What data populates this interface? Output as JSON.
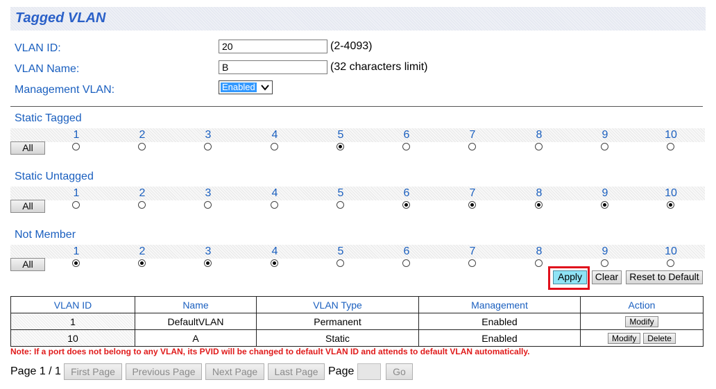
{
  "page": {
    "title": "Tagged VLAN"
  },
  "form": {
    "vlan_id_label": "VLAN ID:",
    "vlan_id_value": "20",
    "vlan_id_hint": "(2-4093)",
    "vlan_name_label": "VLAN Name:",
    "vlan_name_value": "B",
    "vlan_name_hint": "(32 characters limit)",
    "mgmt_label": "Management VLAN:",
    "mgmt_value": "Enabled"
  },
  "membership": {
    "all_label": "All",
    "ports": [
      "1",
      "2",
      "3",
      "4",
      "5",
      "6",
      "7",
      "8",
      "9",
      "10"
    ],
    "sections": [
      {
        "title": "Static Tagged",
        "selected": [
          5
        ]
      },
      {
        "title": "Static Untagged",
        "selected": [
          6,
          7,
          8,
          9,
          10
        ]
      },
      {
        "title": "Not Member",
        "selected": [
          1,
          2,
          3,
          4
        ]
      }
    ]
  },
  "actions": {
    "apply": "Apply",
    "clear": "Clear",
    "reset": "Reset to Default"
  },
  "table": {
    "headers": [
      "VLAN ID",
      "Name",
      "VLAN Type",
      "Management",
      "Action"
    ],
    "rows": [
      {
        "id": "1",
        "name": "DefaultVLAN",
        "type": "Permanent",
        "management": "Enabled",
        "actions": [
          "Modify"
        ]
      },
      {
        "id": "10",
        "name": "A",
        "type": "Static",
        "management": "Enabled",
        "actions": [
          "Modify",
          "Delete"
        ]
      }
    ]
  },
  "note": "Note: If a port does not belong to any VLAN, its PVID will be changed to default VLAN ID and attends to default VLAN automatically.",
  "pager": {
    "page_info": "Page 1 / 1",
    "first": "First Page",
    "previous": "Previous Page",
    "next": "Next Page",
    "last": "Last Page",
    "page_label": "Page",
    "page_input": "",
    "go": "Go"
  },
  "colors": {
    "label_blue": "#1a5fbf",
    "title_blue": "#2a60c8",
    "note_red": "#e01a1a",
    "highlight_red": "#e0101c",
    "apply_bg": "#8fe3f5"
  }
}
